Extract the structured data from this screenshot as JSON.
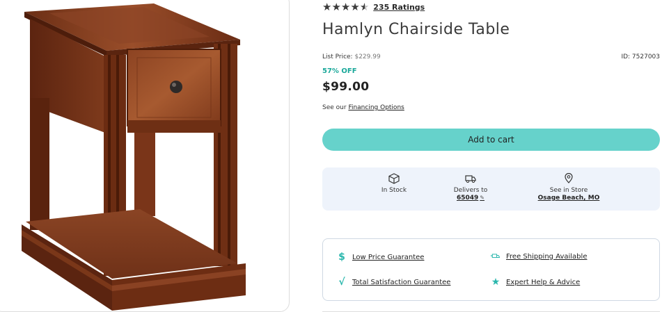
{
  "product": {
    "rating_stars": 4.5,
    "ratings_link": "235 Ratings",
    "title": "Hamlyn Chairside Table",
    "list_price_label": "List Price:",
    "list_price_value": "$229.99",
    "id_label": "ID: 7527003",
    "discount": "57% OFF",
    "price": "$99.00",
    "financing_prefix": "See our",
    "financing_link": "Financing Options",
    "add_to_cart": "Add to cart",
    "image_alt_icon": "chairside-table-image"
  },
  "availability": {
    "stock": {
      "icon": "box-icon",
      "label": "In Stock"
    },
    "delivery": {
      "icon": "truck-icon",
      "label": "Delivers to",
      "zip": "65049",
      "edit_icon": "pencil-icon"
    },
    "store": {
      "icon": "map-pin-icon",
      "label": "See in Store",
      "location": "Osage Beach, MO"
    }
  },
  "guarantees": [
    {
      "icon": "dollar-icon",
      "label": "Low Price Guarantee"
    },
    {
      "icon": "shipping-icon",
      "label": "Free Shipping Available"
    },
    {
      "icon": "check-icon",
      "label": "Total Satisfaction Guarantee"
    },
    {
      "icon": "star-icon",
      "label": "Expert Help & Advice"
    }
  ],
  "colors": {
    "accent": "#66d2cb",
    "discount": "#1aa89a",
    "availability_bg": "#eef3fb",
    "wood": "#7a3a1e"
  }
}
